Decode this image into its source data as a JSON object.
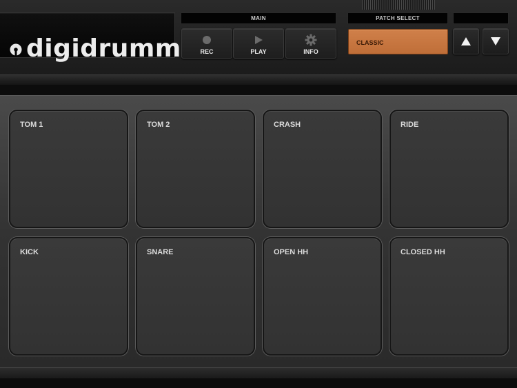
{
  "app": {
    "logo_text": "digidrummer"
  },
  "main_section": {
    "label": "MAIN"
  },
  "patch_section": {
    "label": "PATCH SELECT",
    "current_patch": "CLASSIC"
  },
  "controls": {
    "rec_label": "REC",
    "play_label": "PLAY",
    "info_label": "INFO"
  },
  "pads": [
    {
      "label": "TOM 1"
    },
    {
      "label": "TOM 2"
    },
    {
      "label": "CRASH"
    },
    {
      "label": "RIDE"
    },
    {
      "label": "KICK"
    },
    {
      "label": "SNARE"
    },
    {
      "label": "OPEN HH"
    },
    {
      "label": "CLOSED HH"
    }
  ],
  "colors": {
    "accent": "#c9773f",
    "panel": "#1b1b1b",
    "pad": "#353535"
  }
}
